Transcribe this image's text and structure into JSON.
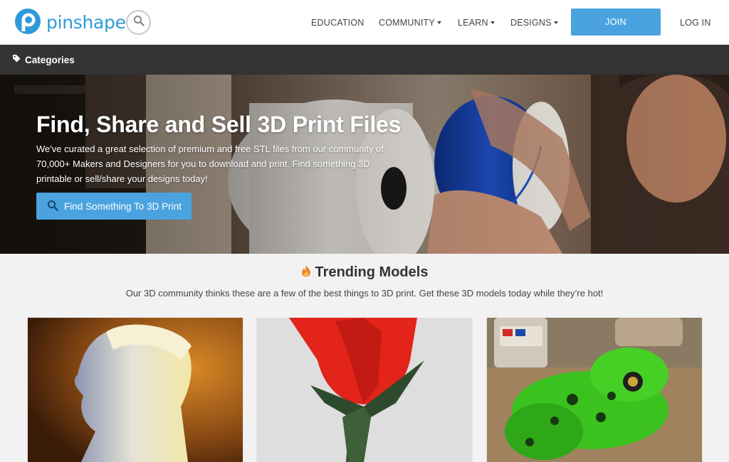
{
  "header": {
    "logo_text": "pinshape",
    "nav": {
      "education": "EDUCATION",
      "community": "COMMUNITY",
      "learn": "LEARN",
      "designs": "DESIGNS"
    },
    "join_label": "JOIN",
    "login_label": "LOG IN"
  },
  "categories_bar": {
    "label": "Categories"
  },
  "hero": {
    "title": "Find, Share and Sell 3D Print Files",
    "description": "We've curated a great selection of premium and free STL files from our community of 70,000+ Makers and Designers for you to download and print. Find something 3D printable or sell/share your designs today!",
    "button_label": "Find Something To 3D Print"
  },
  "trending": {
    "title": "Trending Models",
    "subtitle": "Our 3D community thinks these are a few of the best things to 3D print. Get these 3D models today while they’re hot!"
  },
  "cards": [],
  "colors": {
    "accent": "#4aa3df",
    "brand": "#2e9bd8",
    "dark_bar": "#333333",
    "page_bg": "#f2f2f2"
  },
  "icons": [
    "pinshape-logo-icon",
    "search-icon",
    "tag-icon",
    "flame-icon"
  ]
}
